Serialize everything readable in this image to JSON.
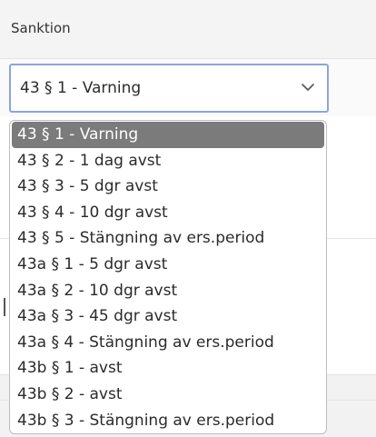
{
  "field": {
    "label": "Sanktion",
    "selected_value": "43 § 1 - Varning",
    "icon": "chevron-down-icon"
  },
  "dropdown": {
    "selected_index": 0,
    "options": [
      "43 § 1 - Varning",
      "43 § 2 - 1 dag avst",
      "43 § 3 - 5 dgr avst",
      "43 § 4 - 10 dgr avst",
      "43 § 5 - Stängning av ers.period",
      "43a § 1 - 5 dgr avst",
      "43a § 2 - 10 dgr avst",
      "43a § 3 - 45 dgr avst",
      "43a § 4 - Stängning av ers.period",
      "43b § 1 - avst",
      "43b § 2 - avst",
      "43b § 3 - Stängning av ers.period"
    ]
  },
  "colors": {
    "focus_border": "#8fa3d9",
    "selected_option_bg": "#7b7b7b",
    "selected_option_text": "#ffffff"
  }
}
